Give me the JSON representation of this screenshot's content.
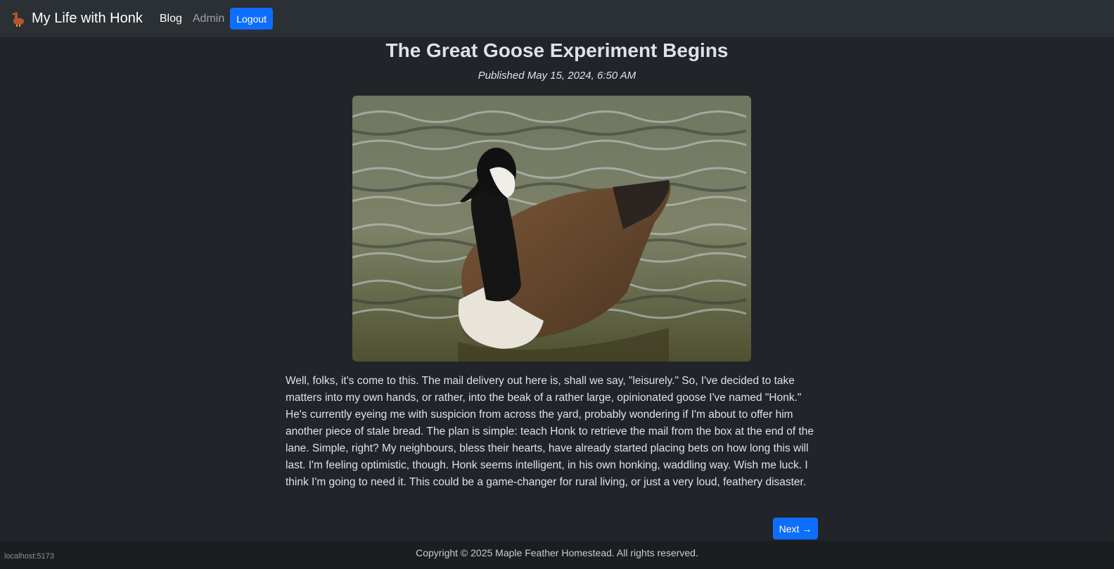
{
  "nav": {
    "brand": "My Life with Honk",
    "blog": "Blog",
    "admin": "Admin",
    "logout": "Logout"
  },
  "post": {
    "title": "The Great Goose Experiment Begins",
    "published": "Published May 15, 2024, 6:50 AM",
    "body": "Well, folks, it's come to this. The mail delivery out here is, shall we say, \"leisurely.\" So, I've decided to take matters into my own hands, or rather, into the beak of a rather large, opinionated goose I've named \"Honk.\" He's currently eyeing me with suspicion from across the yard, probably wondering if I'm about to offer him another piece of stale bread. The plan is simple: teach Honk to retrieve the mail from the box at the end of the lane. Simple, right? My neighbours, bless their hearts, have already started placing bets on how long this will last. I'm feeling optimistic, though. Honk seems intelligent, in his own honking, waddling way. Wish me luck. I think I'm going to need it. This could be a game-changer for rural living, or just a very loud, feathery disaster.",
    "next": "Next →"
  },
  "footer": "Copyright © 2025 Maple Feather Homestead. All rights reserved.",
  "status_url": "localhost:5173",
  "icons": {
    "brand": "goose-icon",
    "hero": "goose-photo"
  },
  "colors": {
    "accent": "#0d6efd",
    "background": "#212529",
    "navbar": "#2b3035"
  }
}
